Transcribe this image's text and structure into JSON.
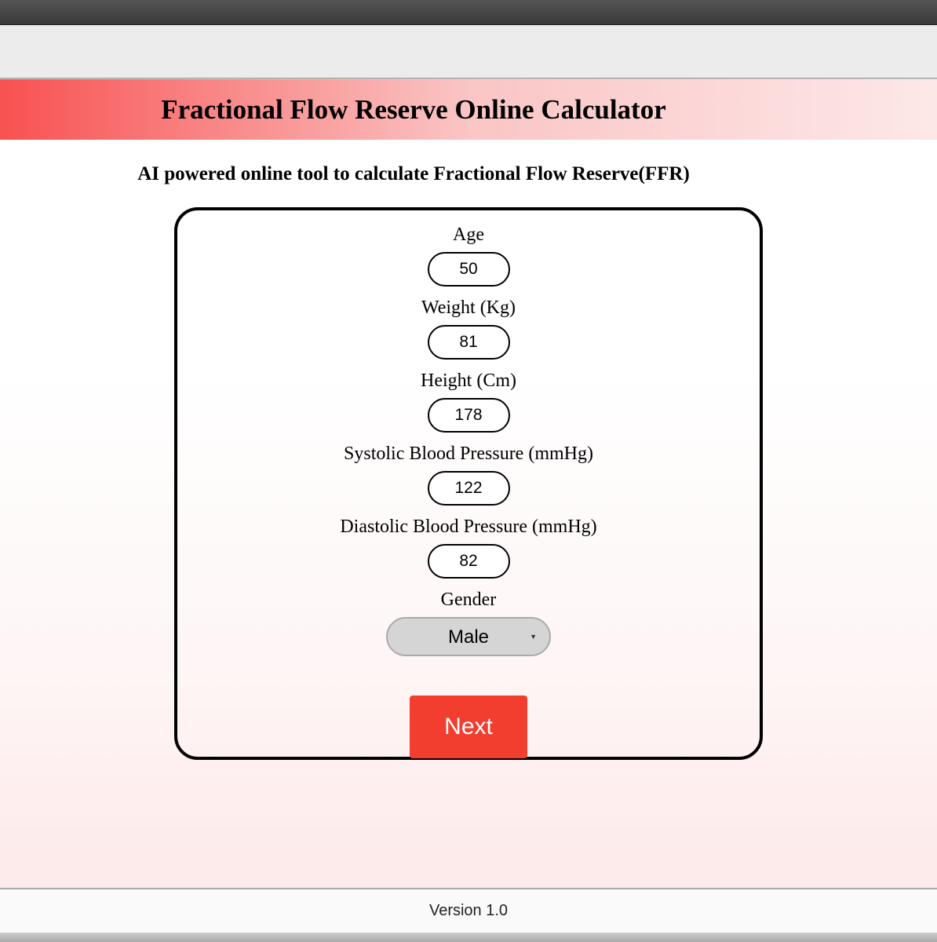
{
  "header": {
    "title": "Fractional Flow Reserve Online Calculator"
  },
  "subtitle": "AI powered online tool to calculate Fractional Flow Reserve(FFR)",
  "form": {
    "fields": [
      {
        "label": "Age",
        "value": "50"
      },
      {
        "label": "Weight (Kg)",
        "value": "81"
      },
      {
        "label": "Height (Cm)",
        "value": "178"
      },
      {
        "label": "Systolic Blood Pressure (mmHg)",
        "value": "122"
      },
      {
        "label": "Diastolic Blood Pressure (mmHg)",
        "value": "82"
      }
    ],
    "gender": {
      "label": "Gender",
      "selected": "Male"
    },
    "next_button_label": "Next"
  },
  "footer": {
    "version": "Version 1.0"
  }
}
